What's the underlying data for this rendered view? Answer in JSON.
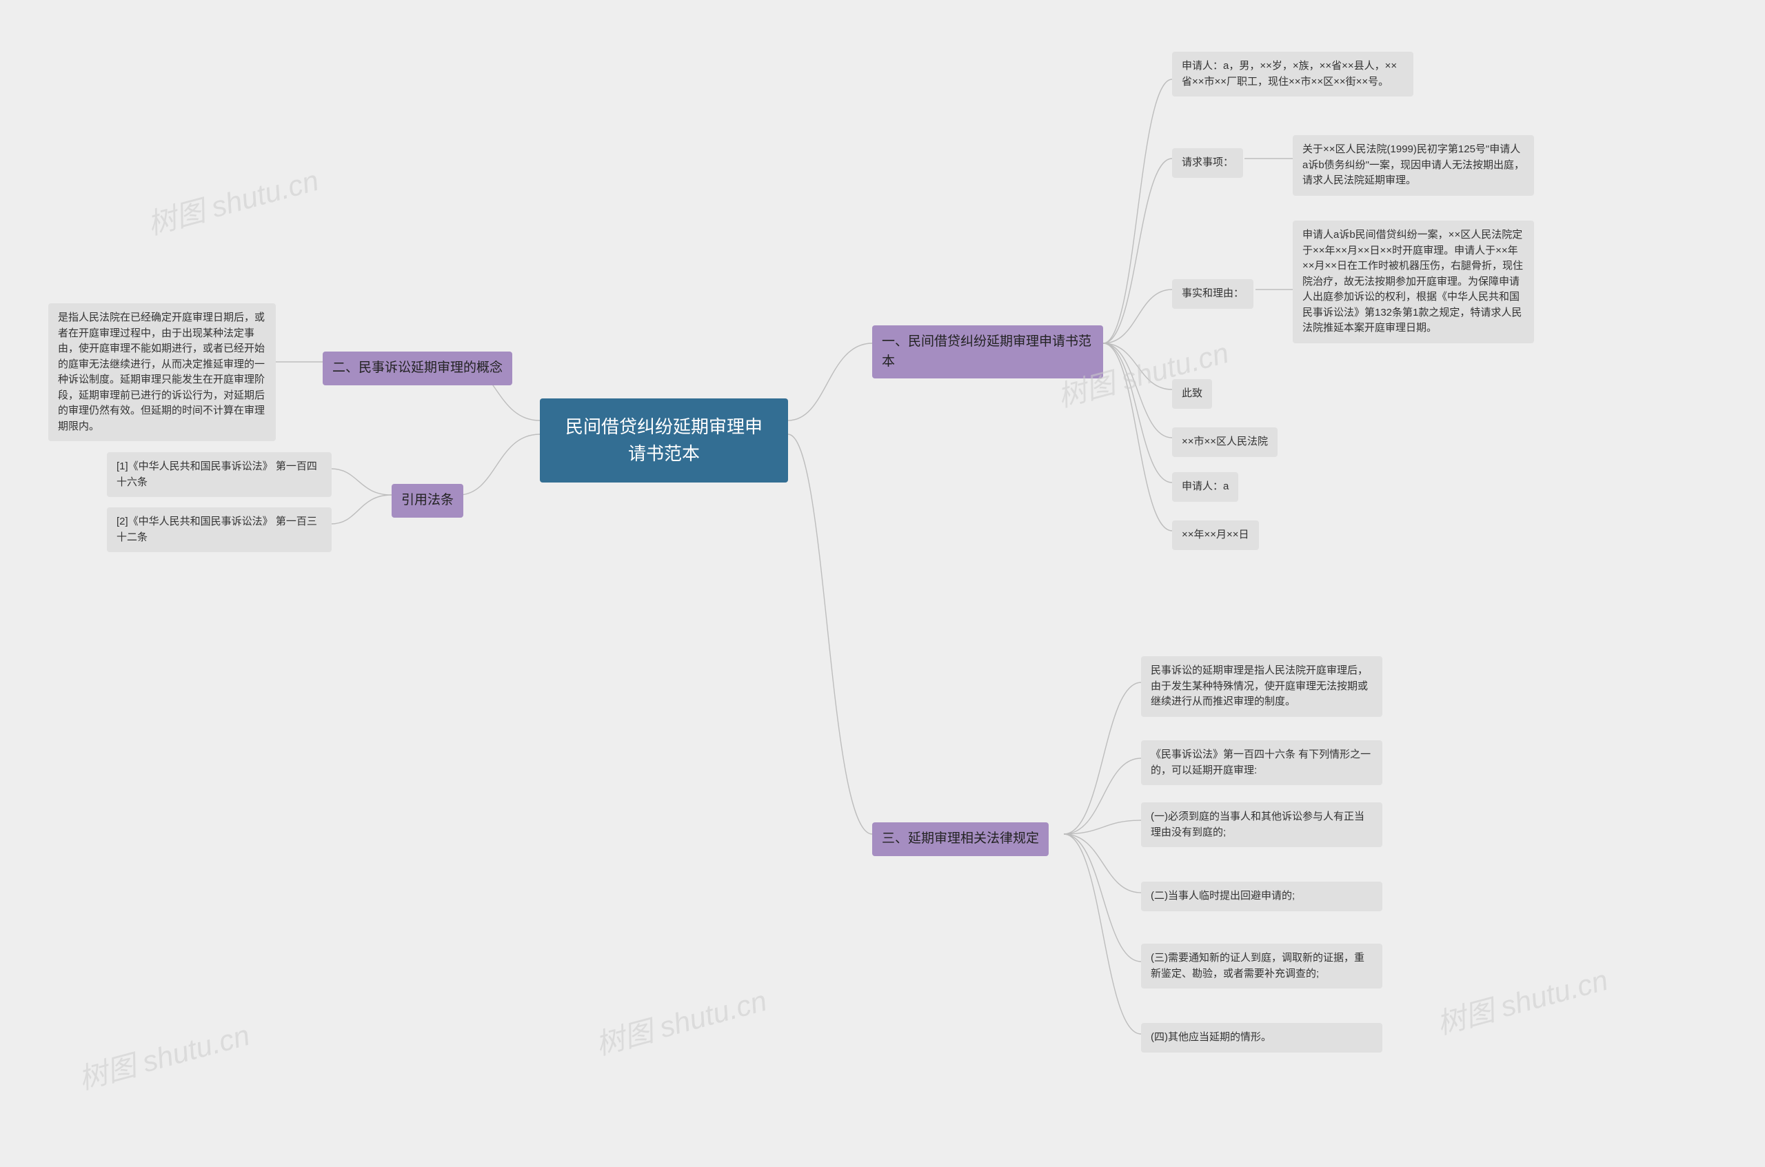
{
  "root": "民间借贷纠纷延期审理申请书范本",
  "section1": {
    "title": "一、民间借贷纠纷延期审理申请书范本",
    "items": {
      "applicant": "申请人：a，男，××岁，×族，××省××县人，××省××市××厂职工，现住××市××区××街××号。",
      "request_label": "请求事项：",
      "request_body": "关于××区人民法院(1999)民初字第125号\"申请人a诉b债务纠纷\"一案，现因申请人无法按期出庭，请求人民法院延期审理。",
      "facts_label": "事实和理由：",
      "facts_body": "申请人a诉b民间借贷纠纷一案，××区人民法院定于××年××月××日××时开庭审理。申请人于××年××月××日在工作时被机器压伤，右腿骨折，现住院治疗，故无法按期参加开庭审理。为保障申请人出庭参加诉讼的权利，根据《中华人民共和国民事诉讼法》第132条第1款之规定，特请求人民法院推延本案开庭审理日期。",
      "cizhi": "此致",
      "court": "××市××区人民法院",
      "signer": "申请人：a",
      "date": "××年××月××日"
    }
  },
  "section2": {
    "title": "二、民事诉讼延期审理的概念",
    "body": "是指人民法院在已经确定开庭审理日期后，或者在开庭审理过程中，由于出现某种法定事由，使开庭审理不能如期进行，或者已经开始的庭审无法继续进行，从而决定推延审理的一种诉讼制度。延期审理只能发生在开庭审理阶段，延期审理前已进行的诉讼行为，对延期后的审理仍然有效。但延期的时间不计算在审理期限内。"
  },
  "section3": {
    "title": "三、延期审理相关法律规定",
    "items": [
      "民事诉讼的延期审理是指人民法院开庭审理后，由于发生某种特殊情况，使开庭审理无法按期或继续进行从而推迟审理的制度。",
      "《民事诉讼法》第一百四十六条 有下列情形之一的，可以延期开庭审理:",
      "(一)必须到庭的当事人和其他诉讼参与人有正当理由没有到庭的;",
      "(二)当事人临时提出回避申请的;",
      "(三)需要通知新的证人到庭，调取新的证据，重新鉴定、勘验，或者需要补充调查的;",
      "(四)其他应当延期的情形。"
    ]
  },
  "refs": {
    "title": "引用法条",
    "items": [
      "[1]《中华人民共和国民事诉讼法》 第一百四十六条",
      "[2]《中华人民共和国民事诉讼法》 第一百三十二条"
    ]
  },
  "watermark": "树图 shutu.cn"
}
